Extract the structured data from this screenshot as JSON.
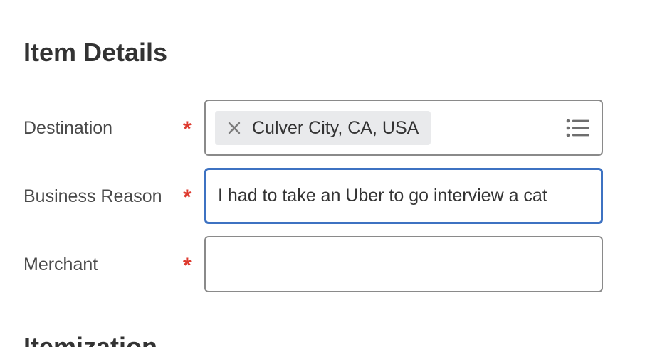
{
  "section": {
    "title": "Item Details",
    "next_title": "Itemization"
  },
  "fields": {
    "destination": {
      "label": "Destination",
      "required_marker": "*",
      "selected_chip": "Culver City, CA, USA",
      "chip_remove_icon": "close-icon",
      "prompt_icon": "list-icon"
    },
    "business_reason": {
      "label": "Business Reason",
      "required_marker": "*",
      "value": "I had to take an Uber to go interview a cat",
      "focused": true
    },
    "merchant": {
      "label": "Merchant",
      "required_marker": "*",
      "value": ""
    }
  },
  "colors": {
    "required": "#de3a2f",
    "focus_border": "#3d72c2",
    "field_border": "#8a8a8a",
    "chip_background": "#e9eaec"
  }
}
